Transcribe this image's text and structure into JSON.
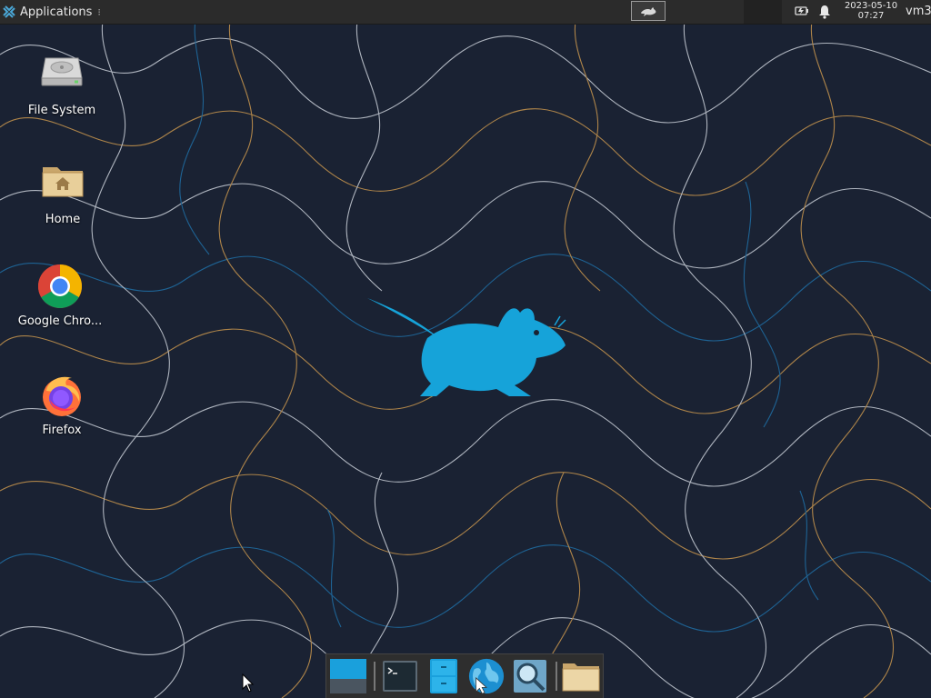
{
  "top_panel": {
    "applications_label": "Applications",
    "menu_separator": "⁝",
    "clock_date": "2023-05-10",
    "clock_time": "07:27",
    "user": "vm3"
  },
  "desktop_icons": [
    {
      "label": "File System",
      "icon": "drive-harddisk-icon"
    },
    {
      "label": "Home",
      "icon": "home-folder-icon"
    },
    {
      "label": "Google Chro...",
      "icon": "google-chrome-icon"
    },
    {
      "label": "Firefox",
      "icon": "firefox-icon"
    }
  ],
  "dock": [
    {
      "name": "show-desktop",
      "icon": "show-desktop-icon"
    },
    {
      "name": "terminal",
      "icon": "terminal-icon"
    },
    {
      "name": "file-cabinet",
      "icon": "file-cabinet-icon"
    },
    {
      "name": "web-browser",
      "icon": "web-browser-icon"
    },
    {
      "name": "app-finder",
      "icon": "search-icon"
    },
    {
      "name": "file-manager",
      "icon": "folder-icon"
    }
  ],
  "colors": {
    "panel": "#2b2b2b",
    "wallpaper": "#1a2233",
    "mouse_logo": "#16a3d9",
    "contour_light": "#c9cfd8",
    "contour_orange": "#c8964e",
    "contour_blue": "#1f6fa6"
  }
}
